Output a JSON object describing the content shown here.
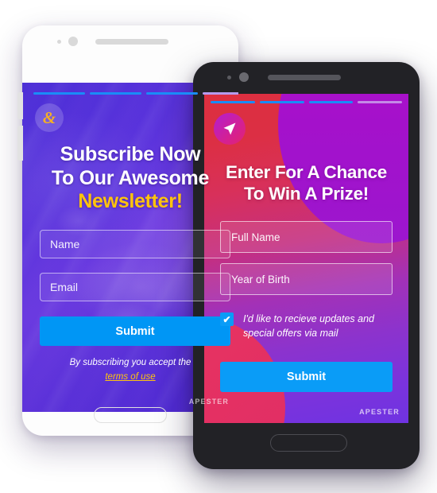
{
  "scene": {
    "background_color": "#ffffff",
    "description": "Two smartphone mockups showing lead-capture unit previews"
  },
  "back_phone": {
    "device_name": "white-phone",
    "frame_color": "#fdfdfd",
    "progress_segments": [
      {
        "color": "#1a8cf7",
        "active": true
      },
      {
        "color": "#1a8cf7",
        "active": true
      },
      {
        "color": "#1a8cf7",
        "active": true
      },
      {
        "color": "#b69bee",
        "active": false
      }
    ],
    "logo_glyph": "&",
    "logo_color": "#f5b024",
    "headline_line1": "Subscribe Now",
    "headline_line2": "To Our Awesome",
    "headline_line3": "Newsletter!",
    "headline_accent_color": "#ffc40d",
    "fields": [
      {
        "name": "name-field",
        "placeholder": "Name",
        "value": ""
      },
      {
        "name": "email-field",
        "placeholder": "Email",
        "value": ""
      }
    ],
    "submit_label": "Submit",
    "submit_color": "#0096f5",
    "terms_text": "By subscribing you accept the",
    "terms_link": "terms of use",
    "brand": "APESTER"
  },
  "front_phone": {
    "device_name": "black-phone",
    "frame_color": "#222226",
    "progress_segments": [
      {
        "color": "#1a8cf7",
        "active": true
      },
      {
        "color": "#1a8cf7",
        "active": true
      },
      {
        "color": "#1a8cf7",
        "active": true
      },
      {
        "color": "#c489e6",
        "active": false
      }
    ],
    "logo_icon": "navigation-arrow-icon",
    "headline_line1": "Enter For A Chance",
    "headline_line2": "To Win A Prize!",
    "fields": [
      {
        "name": "full-name-field",
        "placeholder": "Full Name",
        "value": ""
      },
      {
        "name": "year-of-birth-field",
        "placeholder": "Year of Birth",
        "value": ""
      }
    ],
    "checkbox": {
      "checked": true,
      "check_glyph": "✔",
      "color": "#0a9cf7",
      "label": "I'd like to recieve updates and special offers via mail"
    },
    "submit_label": "Submit",
    "submit_color": "#0a9cf7",
    "brand": "APESTER"
  }
}
